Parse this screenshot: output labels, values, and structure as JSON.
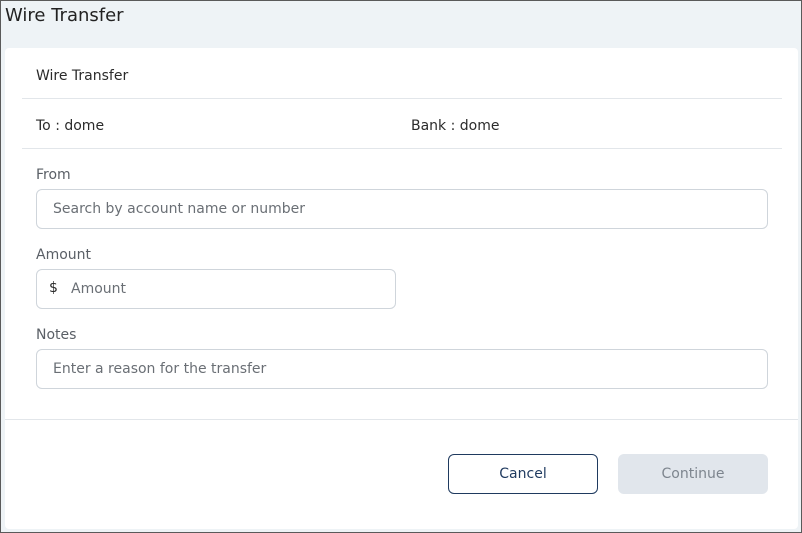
{
  "window": {
    "title": "Wire Transfer"
  },
  "card": {
    "header": "Wire Transfer",
    "recipient": {
      "to": "To : dome",
      "bank": "Bank : dome"
    }
  },
  "form": {
    "from": {
      "label": "From",
      "placeholder": "Search by account name or number",
      "value": ""
    },
    "amount": {
      "label": "Amount",
      "currency_symbol": "$",
      "placeholder": "Amount",
      "value": ""
    },
    "notes": {
      "label": "Notes",
      "placeholder": "Enter a reason for the transfer",
      "value": ""
    }
  },
  "actions": {
    "cancel_label": "Cancel",
    "continue_label": "Continue",
    "continue_disabled": true
  },
  "colors": {
    "page_background": "#eef3f6",
    "card_background": "#ffffff",
    "primary_navy": "#1f3a5f",
    "disabled_button": "#e1e6ec",
    "disabled_text": "#7d858e",
    "input_border": "#cfd5db"
  }
}
